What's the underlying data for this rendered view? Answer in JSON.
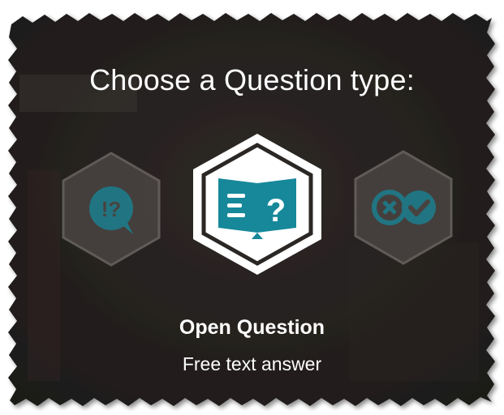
{
  "dialog": {
    "title": "Choose a Question type:",
    "background_color": "#24201e",
    "accent_color": "#16889a"
  },
  "options": [
    {
      "name": "question-prompt",
      "icon": "speech-bubble-exclamation-question-icon",
      "selected": false
    },
    {
      "name": "open-question",
      "icon": "book-question-icon",
      "selected": true,
      "title": "Open Question",
      "subtitle": "Free text answer"
    },
    {
      "name": "true-false",
      "icon": "cross-check-icon",
      "selected": false
    }
  ],
  "selected_option": {
    "title": "Open Question",
    "subtitle": "Free text answer"
  }
}
